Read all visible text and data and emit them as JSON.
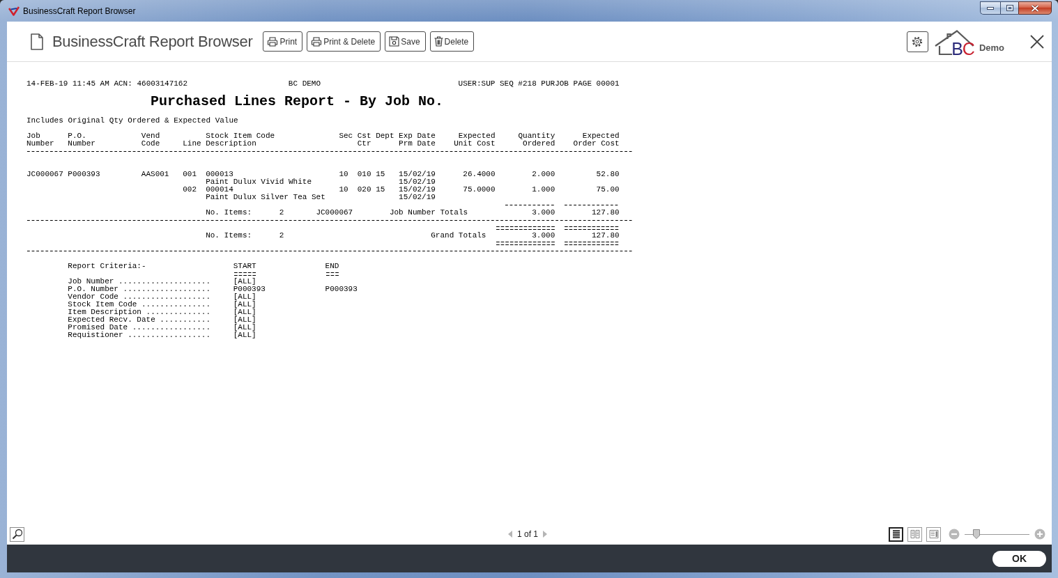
{
  "window": {
    "title": "BusinessCraft Report Browser"
  },
  "toolbar": {
    "title": "BusinessCraft Report Browser",
    "buttons": [
      {
        "label": "Print",
        "kind": "print"
      },
      {
        "label": "Print & Delete",
        "kind": "print-delete"
      },
      {
        "label": "Save",
        "kind": "save"
      },
      {
        "label": "Delete",
        "kind": "delete"
      }
    ],
    "logo": "BC",
    "company": "Demo"
  },
  "report": {
    "header": {
      "left": "14-FEB-19 11:45 AM ACN: 46003147162",
      "center": "BC DEMO",
      "right": "USER:SUP SEQ #218 PURJOB PAGE 00001"
    },
    "title": "Purchased Lines Report - By Job No.",
    "subtitle": "Includes Original Qty Ordered & Expected Value",
    "columns": [
      {
        "top": "Job",
        "bottom": "Number"
      },
      {
        "top": "P.O.",
        "bottom": "Number"
      },
      {
        "top": "Vend",
        "bottom": "Code"
      },
      {
        "bottom": "Line"
      },
      {
        "top": "Stock Item Code",
        "bottom": "Description"
      },
      {
        "top": "Sec"
      },
      {
        "top": "Cst",
        "bottom": "Ctr"
      },
      {
        "top": "Dept"
      },
      {
        "top": "Exp Date",
        "bottom": "Prm Date"
      },
      {
        "top": "Expected",
        "bottom": "Unit Cost"
      },
      {
        "top": "Quantity",
        "bottom": "Ordered"
      },
      {
        "top": "Expected",
        "bottom": "Order Cost"
      }
    ],
    "groups": [
      {
        "job_number": "JC000067",
        "po_number": "P000393",
        "vendor_code": "AAS001",
        "lines": [
          {
            "line": "001",
            "stock_item_code": "000013",
            "description": "Paint Dulux Vivid White",
            "sec": "10",
            "cst_ctr": "010",
            "dept": "15",
            "exp_date": "15/02/19",
            "prm_date": "15/02/19",
            "unit_cost": "26.4000",
            "quantity": "2.000",
            "order_cost": "52.80"
          },
          {
            "line": "002",
            "stock_item_code": "000014",
            "description": "Paint Dulux Silver Tea Set",
            "sec": "10",
            "cst_ctr": "020",
            "dept": "15",
            "exp_date": "15/02/19",
            "prm_date": "15/02/19",
            "unit_cost": "75.0000",
            "quantity": "1.000",
            "order_cost": "75.00"
          }
        ],
        "totals": {
          "items_label": "No. Items:",
          "items": "2",
          "job_number": "JC000067",
          "label": "Job Number Totals",
          "quantity": "3.000",
          "order_cost": "127.80"
        }
      }
    ],
    "grand_totals": {
      "items_label": "No. Items:",
      "items": "2",
      "label": "Grand Totals",
      "quantity": "3.000",
      "order_cost": "127.80"
    },
    "criteria": {
      "title": "Report Criteria:-",
      "start_heading": "START",
      "end_heading": "END",
      "items": [
        {
          "label": "Job Number ....................",
          "start": "[ALL]"
        },
        {
          "label": "P.O. Number ...................",
          "start": "P000393",
          "end": "P000393"
        },
        {
          "label": "Vendor Code ...................",
          "start": "[ALL]"
        },
        {
          "label": "Stock Item Code ...............",
          "start": "[ALL]"
        },
        {
          "label": "Item Description ..............",
          "start": "[ALL]"
        },
        {
          "label": "Expected Recv. Date ...........",
          "start": "[ALL]"
        },
        {
          "label": "Promised Date .................",
          "start": "[ALL]"
        },
        {
          "label": "Requistioner ..................",
          "start": "[ALL]"
        }
      ]
    }
  },
  "pager": {
    "page": "1 of 1",
    "prev_disabled": true,
    "next_disabled": true
  },
  "view_modes": [
    {
      "kind": "single",
      "selected": true
    },
    {
      "kind": "double",
      "selected": false
    },
    {
      "kind": "sidebar",
      "selected": false
    }
  ],
  "zoom": {
    "level": 0.15
  },
  "footer": {
    "button": "OK"
  }
}
